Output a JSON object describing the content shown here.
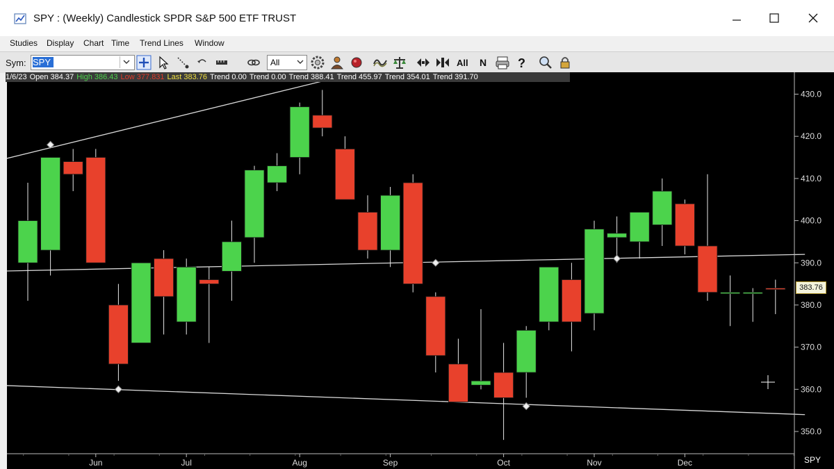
{
  "window": {
    "title": "SPY : (Weekly) Candlestick  SPDR S&P 500 ETF TRUST"
  },
  "menu": [
    "Studies",
    "Display",
    "Chart",
    "Time",
    "Trend Lines",
    "Window"
  ],
  "toolbar": {
    "sym_label": "Sym:",
    "sym_value": "SPY",
    "range_value": "All",
    "tool_icons": [
      "add-icon",
      "pointer-icon",
      "draw-icon",
      "undo-draw-icon",
      "measure-icon",
      "link-icon",
      "gear-icon",
      "person-icon",
      "record-icon",
      "wave-icon",
      "balance-icon",
      "zoom-in-icon",
      "zoom-out-icon",
      "all-text-icon",
      "n-text-icon",
      "print-icon",
      "help-icon",
      "search-icon",
      "lock-icon"
    ],
    "text_buttons": {
      "all": "All",
      "n": "N"
    }
  },
  "info": {
    "date": "1/6/23",
    "open": "Open 384.37",
    "high": "High 386.43",
    "low": "Low 377.831",
    "last": "Last 383.76",
    "trends": [
      "Trend 0.00",
      "Trend 0.00",
      "Trend 388.41",
      "Trend 455.97",
      "Trend 354.01",
      "Trend 391.70"
    ]
  },
  "last_price": "383.76",
  "symbol_tag": "SPY",
  "colors": {
    "up": "#4cd34c",
    "down": "#e8412c",
    "background": "#000000",
    "trend_line": "#d8d8d8"
  },
  "chart_data": {
    "type": "candlestick",
    "y_ticks": [
      430,
      420,
      410,
      400,
      390,
      380,
      370,
      360,
      350
    ],
    "ylim": [
      346,
      432
    ],
    "month_labels": [
      {
        "label": "Jun",
        "week": 3
      },
      {
        "label": "Jul",
        "week": 7
      },
      {
        "label": "Aug",
        "week": 12
      },
      {
        "label": "Sep",
        "week": 16
      },
      {
        "label": "Oct",
        "week": 21
      },
      {
        "label": "Nov",
        "week": 25
      },
      {
        "label": "Dec",
        "week": 29
      }
    ],
    "candles": [
      {
        "o": 390,
        "h": 409,
        "l": 381,
        "c": 400
      },
      {
        "o": 393,
        "h": 415,
        "l": 387,
        "c": 415
      },
      {
        "o": 414,
        "h": 417,
        "l": 407,
        "c": 411
      },
      {
        "o": 415,
        "h": 417,
        "l": 390,
        "c": 390
      },
      {
        "o": 380,
        "h": 385,
        "l": 362,
        "c": 366
      },
      {
        "o": 371,
        "h": 390,
        "l": 371,
        "c": 390
      },
      {
        "o": 391,
        "h": 393,
        "l": 373,
        "c": 382
      },
      {
        "o": 376,
        "h": 391,
        "l": 373,
        "c": 389
      },
      {
        "o": 386,
        "h": 389,
        "l": 371,
        "c": 385
      },
      {
        "o": 388,
        "h": 400,
        "l": 381,
        "c": 395
      },
      {
        "o": 396,
        "h": 413,
        "l": 390,
        "c": 412
      },
      {
        "o": 409,
        "h": 416,
        "l": 407,
        "c": 413
      },
      {
        "o": 415,
        "h": 428,
        "l": 411,
        "c": 427
      },
      {
        "o": 425,
        "h": 431,
        "l": 420,
        "c": 422
      },
      {
        "o": 417,
        "h": 420,
        "l": 405,
        "c": 405
      },
      {
        "o": 402,
        "h": 406,
        "l": 391,
        "c": 393
      },
      {
        "o": 393,
        "h": 408,
        "l": 389,
        "c": 406
      },
      {
        "o": 409,
        "h": 411,
        "l": 383,
        "c": 385
      },
      {
        "o": 382,
        "h": 383,
        "l": 364,
        "c": 368
      },
      {
        "o": 366,
        "h": 372,
        "l": 357,
        "c": 357
      },
      {
        "o": 361,
        "h": 379,
        "l": 360,
        "c": 362
      },
      {
        "o": 364,
        "h": 371,
        "l": 348,
        "c": 358
      },
      {
        "o": 364,
        "h": 375,
        "l": 358,
        "c": 374
      },
      {
        "o": 376,
        "h": 389,
        "l": 374,
        "c": 389
      },
      {
        "o": 386,
        "h": 390,
        "l": 369,
        "c": 376
      },
      {
        "o": 378,
        "h": 400,
        "l": 374,
        "c": 398
      },
      {
        "o": 396,
        "h": 401,
        "l": 390,
        "c": 397
      },
      {
        "o": 395,
        "h": 402,
        "l": 391,
        "c": 402
      },
      {
        "o": 399,
        "h": 410,
        "l": 394,
        "c": 407
      },
      {
        "o": 404,
        "h": 405,
        "l": 392,
        "c": 394
      },
      {
        "o": 394,
        "h": 411,
        "l": 381,
        "c": 383
      },
      {
        "o": 383,
        "h": 387,
        "l": 375,
        "c": 383
      },
      {
        "o": 383,
        "h": 384,
        "l": 376,
        "c": 383
      },
      {
        "o": 384,
        "h": 386,
        "l": 377.831,
        "c": 383.76
      }
    ],
    "trend_lines": [
      {
        "w1": -1.5,
        "y1": 414,
        "w2": 13.7,
        "y2": 434
      },
      {
        "w1": -1.5,
        "y1": 388,
        "w2": 34.3,
        "y2": 392
      },
      {
        "w1": -1.5,
        "y1": 361,
        "w2": 34.3,
        "y2": 354
      }
    ],
    "anchors": [
      {
        "w": 1,
        "v": 418
      },
      {
        "w": 4,
        "v": 360
      },
      {
        "w": 18,
        "v": 390
      },
      {
        "w": 22,
        "v": 356
      },
      {
        "w": 26,
        "v": 391
      }
    ]
  }
}
